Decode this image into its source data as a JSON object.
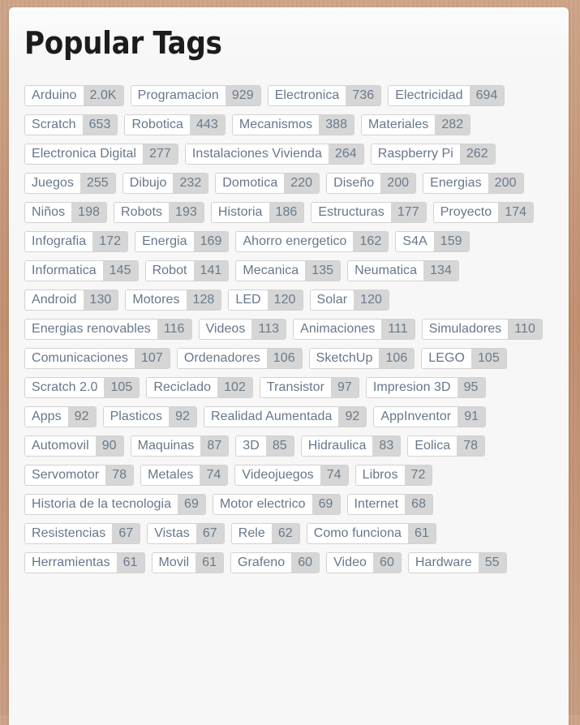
{
  "header": {
    "title": "Popular Tags"
  },
  "theme": {
    "page_background": "#c79a7b",
    "card_background": "#f7f7f7",
    "title_color": "#1c1c1c",
    "tag_border": "#d2d2d2",
    "tag_label_background": "#ffffff",
    "tag_count_background": "#d6d6d6",
    "tag_text_color": "#67778a"
  },
  "tags": [
    {
      "label": "Arduino",
      "count": "2.0K"
    },
    {
      "label": "Programacion",
      "count": "929"
    },
    {
      "label": "Electronica",
      "count": "736"
    },
    {
      "label": "Electricidad",
      "count": "694"
    },
    {
      "label": "Scratch",
      "count": "653"
    },
    {
      "label": "Robotica",
      "count": "443"
    },
    {
      "label": "Mecanismos",
      "count": "388"
    },
    {
      "label": "Materiales",
      "count": "282"
    },
    {
      "label": "Electronica Digital",
      "count": "277"
    },
    {
      "label": "Instalaciones Vivienda",
      "count": "264"
    },
    {
      "label": "Raspberry Pi",
      "count": "262"
    },
    {
      "label": "Juegos",
      "count": "255"
    },
    {
      "label": "Dibujo",
      "count": "232"
    },
    {
      "label": "Domotica",
      "count": "220"
    },
    {
      "label": "Diseño",
      "count": "200"
    },
    {
      "label": "Energias",
      "count": "200"
    },
    {
      "label": "Niños",
      "count": "198"
    },
    {
      "label": "Robots",
      "count": "193"
    },
    {
      "label": "Historia",
      "count": "186"
    },
    {
      "label": "Estructuras",
      "count": "177"
    },
    {
      "label": "Proyecto",
      "count": "174"
    },
    {
      "label": "Infografia",
      "count": "172"
    },
    {
      "label": "Energia",
      "count": "169"
    },
    {
      "label": "Ahorro energetico",
      "count": "162"
    },
    {
      "label": "S4A",
      "count": "159"
    },
    {
      "label": "Informatica",
      "count": "145"
    },
    {
      "label": "Robot",
      "count": "141"
    },
    {
      "label": "Mecanica",
      "count": "135"
    },
    {
      "label": "Neumatica",
      "count": "134"
    },
    {
      "label": "Android",
      "count": "130"
    },
    {
      "label": "Motores",
      "count": "128"
    },
    {
      "label": "LED",
      "count": "120"
    },
    {
      "label": "Solar",
      "count": "120"
    },
    {
      "label": "Energias renovables",
      "count": "116"
    },
    {
      "label": "Videos",
      "count": "113"
    },
    {
      "label": "Animaciones",
      "count": "111"
    },
    {
      "label": "Simuladores",
      "count": "110"
    },
    {
      "label": "Comunicaciones",
      "count": "107"
    },
    {
      "label": "Ordenadores",
      "count": "106"
    },
    {
      "label": "SketchUp",
      "count": "106"
    },
    {
      "label": "LEGO",
      "count": "105"
    },
    {
      "label": "Scratch 2.0",
      "count": "105"
    },
    {
      "label": "Reciclado",
      "count": "102"
    },
    {
      "label": "Transistor",
      "count": "97"
    },
    {
      "label": "Impresion 3D",
      "count": "95"
    },
    {
      "label": "Apps",
      "count": "92"
    },
    {
      "label": "Plasticos",
      "count": "92"
    },
    {
      "label": "Realidad Aumentada",
      "count": "92"
    },
    {
      "label": "AppInventor",
      "count": "91"
    },
    {
      "label": "Automovil",
      "count": "90"
    },
    {
      "label": "Maquinas",
      "count": "87"
    },
    {
      "label": "3D",
      "count": "85"
    },
    {
      "label": "Hidraulica",
      "count": "83"
    },
    {
      "label": "Eolica",
      "count": "78"
    },
    {
      "label": "Servomotor",
      "count": "78"
    },
    {
      "label": "Metales",
      "count": "74"
    },
    {
      "label": "Videojuegos",
      "count": "74"
    },
    {
      "label": "Libros",
      "count": "72"
    },
    {
      "label": "Historia de la tecnologia",
      "count": "69"
    },
    {
      "label": "Motor electrico",
      "count": "69"
    },
    {
      "label": "Internet",
      "count": "68"
    },
    {
      "label": "Resistencias",
      "count": "67"
    },
    {
      "label": "Vistas",
      "count": "67"
    },
    {
      "label": "Rele",
      "count": "62"
    },
    {
      "label": "Como funciona",
      "count": "61"
    },
    {
      "label": "Herramientas",
      "count": "61"
    },
    {
      "label": "Movil",
      "count": "61"
    },
    {
      "label": "Grafeno",
      "count": "60"
    },
    {
      "label": "Video",
      "count": "60"
    },
    {
      "label": "Hardware",
      "count": "55"
    }
  ]
}
